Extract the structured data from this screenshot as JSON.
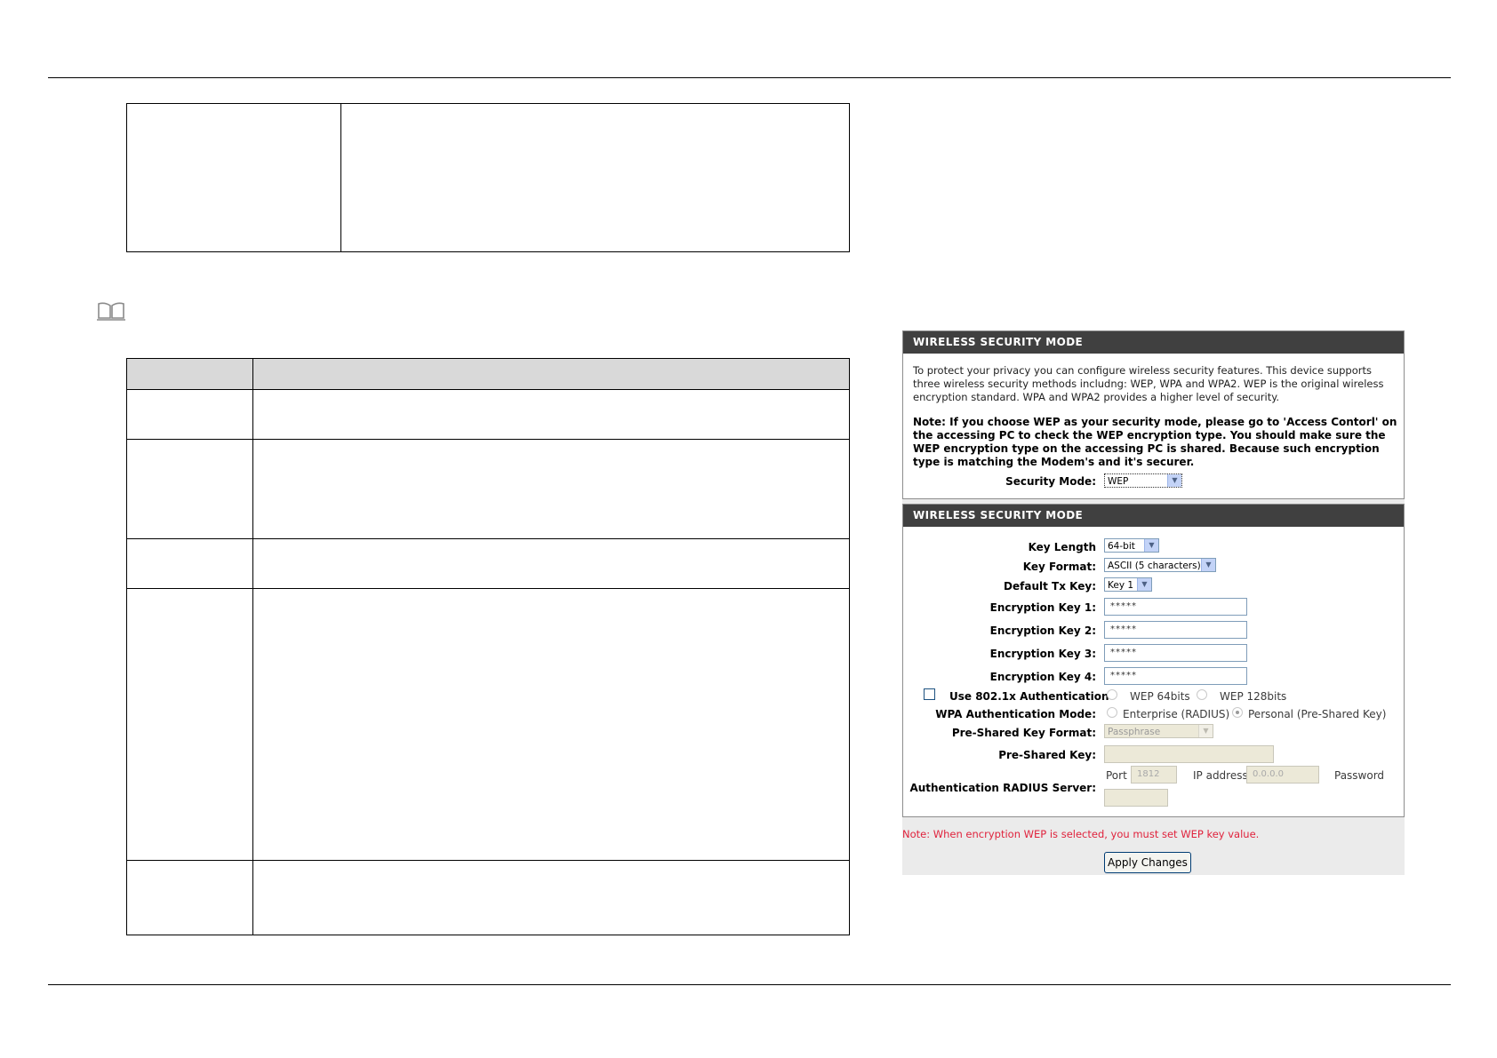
{
  "security_mode_box": {
    "title": "WIRELESS SECURITY MODE",
    "intro": "To protect your privacy you can configure wireless security features. This device supports three wireless security methods includng: WEP, WPA and WPA2. WEP is the original wireless encryption standard. WPA and WPA2 provides a higher level of security.",
    "note": "Note: If you choose WEP as your security mode, please go to 'Access Contorl' on the accessing PC to check the WEP encryption type. You should make sure the WEP encryption type on the accessing PC is shared. Because such encryption type is matching the Modem's and it's securer.",
    "security_mode_label": "Security Mode:",
    "security_mode_value": "WEP"
  },
  "wep_box": {
    "title": "WIRELESS SECURITY MODE",
    "key_length_label": "Key Length",
    "key_length_value": "64-bit",
    "key_format_label": "Key Format:",
    "key_format_value": "ASCII (5 characters)",
    "default_tx_key_label": "Default Tx Key:",
    "default_tx_key_value": "Key 1",
    "encryption_keys": [
      {
        "label": "Encryption Key 1:",
        "value": "*****"
      },
      {
        "label": "Encryption Key 2:",
        "value": "*****"
      },
      {
        "label": "Encryption Key 3:",
        "value": "*****"
      },
      {
        "label": "Encryption Key 4:",
        "value": "*****"
      }
    ],
    "use_8021x_label": "Use 802.1x Authentication",
    "use_8021x_checked": false,
    "wep64_label": "WEP 64bits",
    "wep128_label": "WEP 128bits",
    "wpa_auth_mode_label": "WPA Authentication Mode:",
    "enterprise_label": "Enterprise (RADIUS)",
    "personal_label": "Personal (Pre-Shared Key)",
    "psk_format_label": "Pre-Shared Key Format:",
    "psk_format_value": "Passphrase",
    "psk_label": "Pre-Shared Key:",
    "psk_value": "",
    "radius_label": "Authentication RADIUS Server:",
    "port_label": "Port",
    "port_value": "1812",
    "ip_label": "IP address",
    "ip_value": "0.0.0.0",
    "password_label": "Password",
    "password_value": ""
  },
  "footer": {
    "note": "Note: When encryption WEP is selected, you must set WEP key value.",
    "apply_label": "Apply Changes"
  },
  "colors": {
    "panel_header": "#404040",
    "note_red": "#e0223c",
    "table_header": "#d9d9d9"
  },
  "icons": [
    "book-icon",
    "dropdown-arrow-icon"
  ]
}
